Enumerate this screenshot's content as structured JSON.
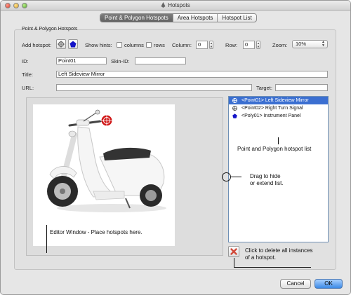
{
  "window": {
    "title": "Hotspots"
  },
  "tabs": [
    {
      "label": "Point & Polygon Hotspots",
      "active": true
    },
    {
      "label": "Area Hotspots",
      "active": false
    },
    {
      "label": "Hotspot List",
      "active": false
    }
  ],
  "group": {
    "label": "Point & Polygon Hotspots"
  },
  "toolbar": {
    "add_hotspot_label": "Add hotspot:",
    "show_hints_label": "Show hints:",
    "columns_label": "columns",
    "rows_label": "rows",
    "column_label": "Column:",
    "column_value": "0",
    "row_label": "Row:",
    "row_value": "0",
    "zoom_label": "Zoom:",
    "zoom_value": "10%"
  },
  "fields": {
    "id_label": "ID:",
    "id_value": "Point01",
    "skin_id_label": "Skin-ID:",
    "skin_id_value": "",
    "title_label": "Title:",
    "title_value": "Left Sideview Mirror",
    "url_label": "URL:",
    "url_value": "",
    "target_label": "Target:",
    "target_value": ""
  },
  "hotspot_list": [
    {
      "label": "<Point01> Left Sideview Mirror",
      "icon": "point-hotspot-icon",
      "selected": true
    },
    {
      "label": "<Point02> Right Turn Signal",
      "icon": "point-hotspot-icon",
      "selected": false
    },
    {
      "label": "<Poly01> Instrument Panel",
      "icon": "polygon-hotspot-icon",
      "selected": false
    }
  ],
  "annotations": {
    "list": "Point and Polygon hotspot list",
    "drag_line1": "Drag to hide",
    "drag_line2": "or extend list.",
    "editor": "Editor Window - Place hotspots here.",
    "delete_line1": "Click to delete all instances",
    "delete_line2": "of a hotspot."
  },
  "buttons": {
    "cancel": "Cancel",
    "ok": "OK"
  },
  "colors": {
    "selection": "#3b6fd1",
    "polygon_blue": "#1414c8",
    "hotspot_red": "#d01818"
  }
}
